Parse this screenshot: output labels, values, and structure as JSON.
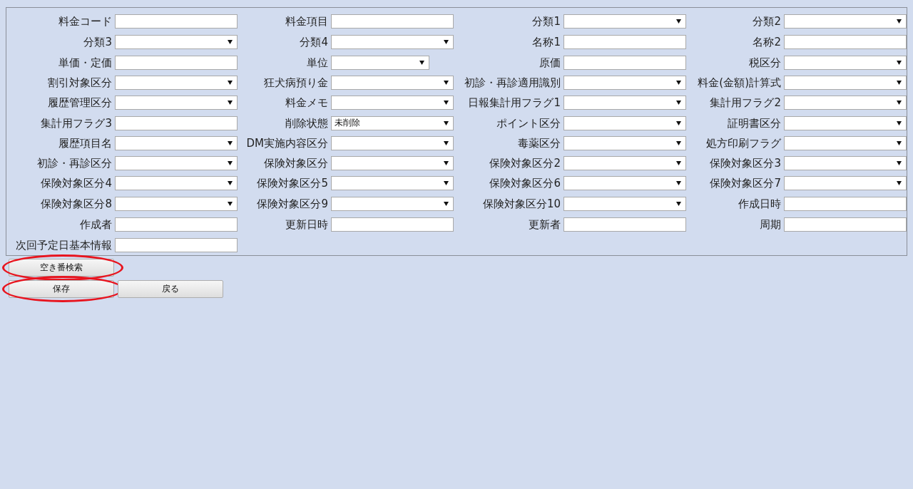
{
  "fields": [
    {
      "label": "料金コード",
      "kind": "text"
    },
    {
      "label": "料金項目",
      "kind": "text"
    },
    {
      "label": "分類1",
      "kind": "select"
    },
    {
      "label": "分類2",
      "kind": "select"
    },
    {
      "label": "分類3",
      "kind": "select"
    },
    {
      "label": "分類4",
      "kind": "select"
    },
    {
      "label": "名称1",
      "kind": "text"
    },
    {
      "label": "名称2",
      "kind": "text"
    },
    {
      "label": "単価・定価",
      "kind": "text"
    },
    {
      "label": "単位",
      "kind": "short-select"
    },
    {
      "label": "原価",
      "kind": "text"
    },
    {
      "label": "税区分",
      "kind": "select"
    },
    {
      "label": "割引対象区分",
      "kind": "select"
    },
    {
      "label": "狂犬病預り金",
      "kind": "select"
    },
    {
      "label": "初診・再診適用識別",
      "kind": "select"
    },
    {
      "label": "料金(金額)計算式",
      "kind": "select"
    },
    {
      "label": "履歴管理区分",
      "kind": "select"
    },
    {
      "label": "料金メモ",
      "kind": "select"
    },
    {
      "label": "日報集計用フラグ1",
      "kind": "select"
    },
    {
      "label": "集計用フラグ2",
      "kind": "select"
    },
    {
      "label": "集計用フラグ3",
      "kind": "text"
    },
    {
      "label": "削除状態",
      "kind": "select",
      "value": "未削除"
    },
    {
      "label": "ポイント区分",
      "kind": "select"
    },
    {
      "label": "証明書区分",
      "kind": "select"
    },
    {
      "label": "履歴項目名",
      "kind": "select"
    },
    {
      "label": "DM実施内容区分",
      "kind": "select"
    },
    {
      "label": "毒薬区分",
      "kind": "select"
    },
    {
      "label": "処方印刷フラグ",
      "kind": "select"
    },
    {
      "label": "初診・再診区分",
      "kind": "select"
    },
    {
      "label": "保険対象区分",
      "kind": "select"
    },
    {
      "label": "保険対象区分2",
      "kind": "select"
    },
    {
      "label": "保険対象区分3",
      "kind": "select"
    },
    {
      "label": "保険対象区分4",
      "kind": "select"
    },
    {
      "label": "保険対象区分5",
      "kind": "select"
    },
    {
      "label": "保険対象区分6",
      "kind": "select"
    },
    {
      "label": "保険対象区分7",
      "kind": "select"
    },
    {
      "label": "保険対象区分8",
      "kind": "select"
    },
    {
      "label": "保険対象区分9",
      "kind": "select"
    },
    {
      "label": "保険対象区分10",
      "kind": "select"
    },
    {
      "label": "作成日時",
      "kind": "text"
    },
    {
      "label": "作成者",
      "kind": "text"
    },
    {
      "label": "更新日時",
      "kind": "text"
    },
    {
      "label": "更新者",
      "kind": "text"
    },
    {
      "label": "周期",
      "kind": "text"
    },
    {
      "label": "次回予定日基本情報",
      "kind": "text"
    }
  ],
  "button_rows": [
    [
      {
        "label": "空き番検索",
        "circled": true
      }
    ],
    [
      {
        "label": "保存",
        "circled": true
      },
      {
        "label": "戻る",
        "circled": false
      }
    ]
  ]
}
